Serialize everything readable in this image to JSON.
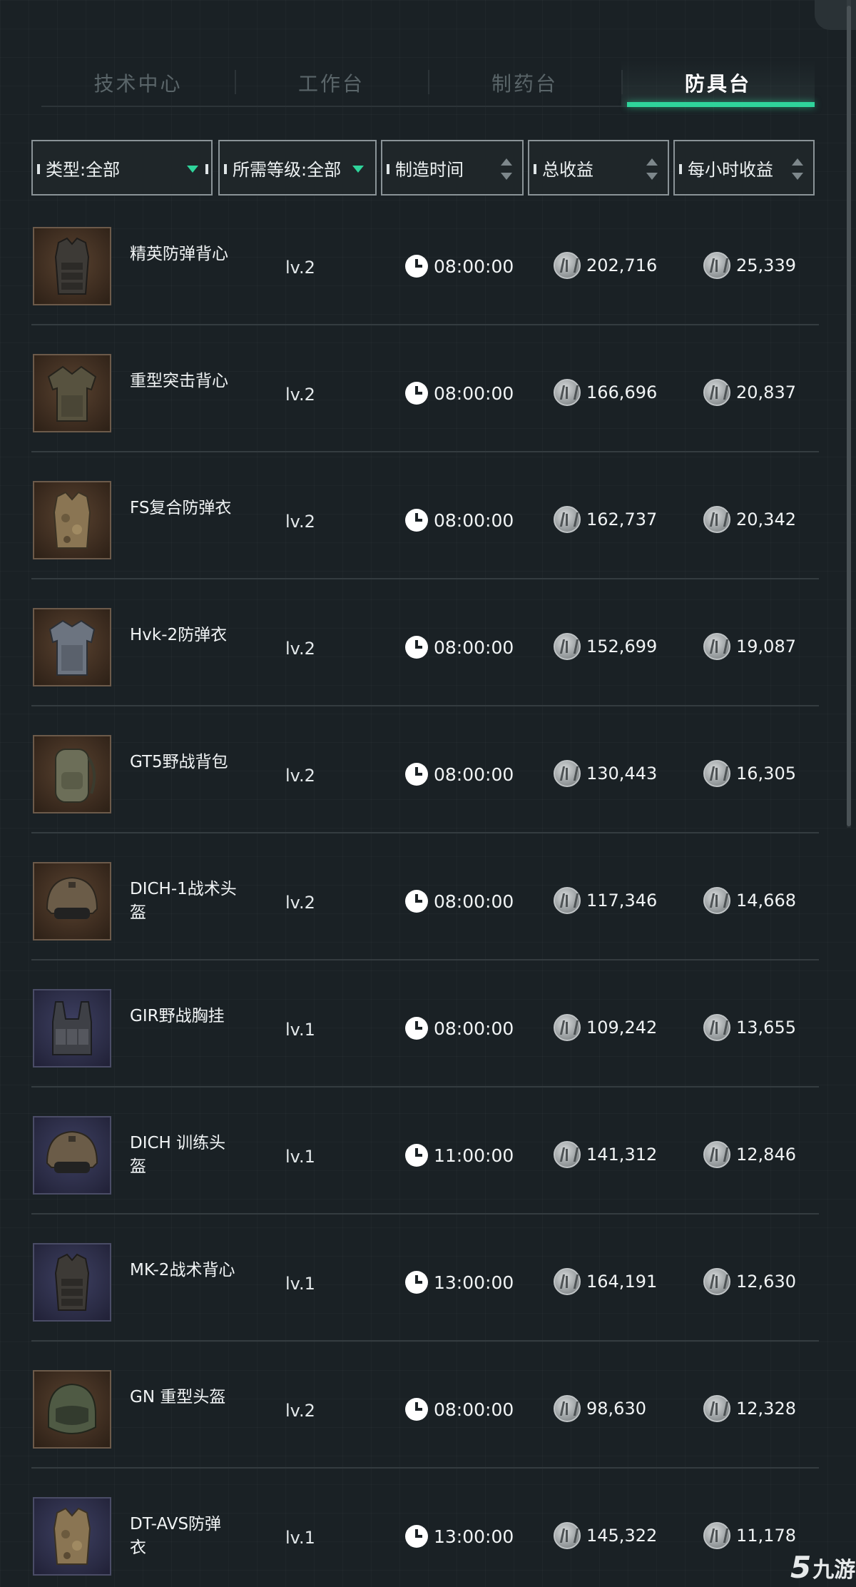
{
  "tabs": [
    {
      "label": "技术中心",
      "active": false
    },
    {
      "label": "工作台",
      "active": false
    },
    {
      "label": "制药台",
      "active": false
    },
    {
      "label": "防具台",
      "active": true
    }
  ],
  "filters": {
    "type": "类型:全部",
    "level": "所需等级:全部",
    "time": "制造时间",
    "total": "总收益",
    "hourly": "每小时收益"
  },
  "colors": {
    "accent": "#2fd49b",
    "background": "#1a2125"
  },
  "items": [
    {
      "name": "精英防弹背心",
      "level": "lv.2",
      "time": "08:00:00",
      "total": "202,716",
      "hourly": "25,339",
      "icon": "vest-icon",
      "frame": "brown"
    },
    {
      "name": "重型突击背心",
      "level": "lv.2",
      "time": "08:00:00",
      "total": "166,696",
      "hourly": "20,837",
      "icon": "heavy-vest-icon",
      "frame": "brown"
    },
    {
      "name": "FS复合防弹衣",
      "level": "lv.2",
      "time": "08:00:00",
      "total": "162,737",
      "hourly": "20,342",
      "icon": "camo-vest-icon",
      "frame": "brown"
    },
    {
      "name": "Hvk-2防弹衣",
      "level": "lv.2",
      "time": "08:00:00",
      "total": "152,699",
      "hourly": "19,087",
      "icon": "armor-vest-icon",
      "frame": "brown"
    },
    {
      "name": "GT5野战背包",
      "level": "lv.2",
      "time": "08:00:00",
      "total": "130,443",
      "hourly": "16,305",
      "icon": "backpack-icon",
      "frame": "brown"
    },
    {
      "name": "DICH-1战术头盔",
      "level": "lv.2",
      "time": "08:00:00",
      "total": "117,346",
      "hourly": "14,668",
      "icon": "helmet-icon",
      "frame": "brown"
    },
    {
      "name": "GIR野战胸挂",
      "level": "lv.1",
      "time": "08:00:00",
      "total": "109,242",
      "hourly": "13,655",
      "icon": "chest-rig-icon",
      "frame": "blue"
    },
    {
      "name": "DICH 训练头盔",
      "level": "lv.1",
      "time": "11:00:00",
      "total": "141,312",
      "hourly": "12,846",
      "icon": "helmet-icon",
      "frame": "blue"
    },
    {
      "name": "MK-2战术背心",
      "level": "lv.1",
      "time": "13:00:00",
      "total": "164,191",
      "hourly": "12,630",
      "icon": "vest-icon",
      "frame": "blue"
    },
    {
      "name": "GN 重型头盔",
      "level": "lv.2",
      "time": "08:00:00",
      "total": "98,630",
      "hourly": "12,328",
      "icon": "heavy-helmet-icon",
      "frame": "brown"
    },
    {
      "name": "DT-AVS防弹衣",
      "level": "lv.1",
      "time": "13:00:00",
      "total": "145,322",
      "hourly": "11,178",
      "icon": "camo-vest-icon",
      "frame": "blue"
    }
  ],
  "watermark": {
    "five": "5",
    "text": "九游"
  }
}
